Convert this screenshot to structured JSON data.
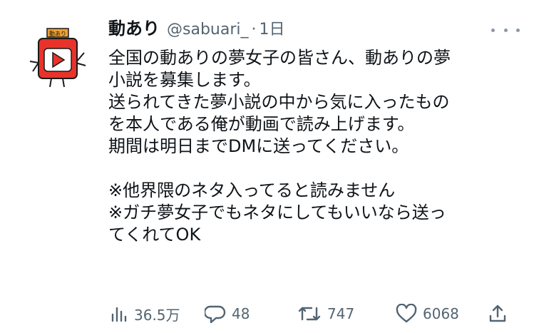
{
  "tweet": {
    "display_name": "動あり",
    "handle": "@sabuari_",
    "separator": "·",
    "time": "1日",
    "avatar": {
      "badge_text": "動あり",
      "colors": {
        "red": "#e8332a",
        "outline": "#1a1a1a",
        "badge": "#f0a030"
      }
    },
    "more_icon": "more-horizontal-icon",
    "lines": [
      "全国の動ありの夢女子の皆さん、動ありの夢",
      "小説を募集します。",
      "送られてきた夢小説の中から気に入ったもの",
      "を本人である俺が動画で読み上げます。",
      "期間は明日までDMに送ってください。",
      "",
      "※他界隈のネタ入ってると読みません",
      "※ガチ夢女子でもネタにしてもいいなら送っ",
      "てくれてOK"
    ],
    "actions": {
      "views": {
        "icon": "views-icon",
        "count": "36.5万"
      },
      "reply": {
        "icon": "reply-icon",
        "count": "48"
      },
      "retweet": {
        "icon": "retweet-icon",
        "count": "747"
      },
      "like": {
        "icon": "heart-icon",
        "count": "6068"
      },
      "share": {
        "icon": "share-icon"
      }
    },
    "colors": {
      "text": "#0f1419",
      "muted": "#536471"
    }
  }
}
